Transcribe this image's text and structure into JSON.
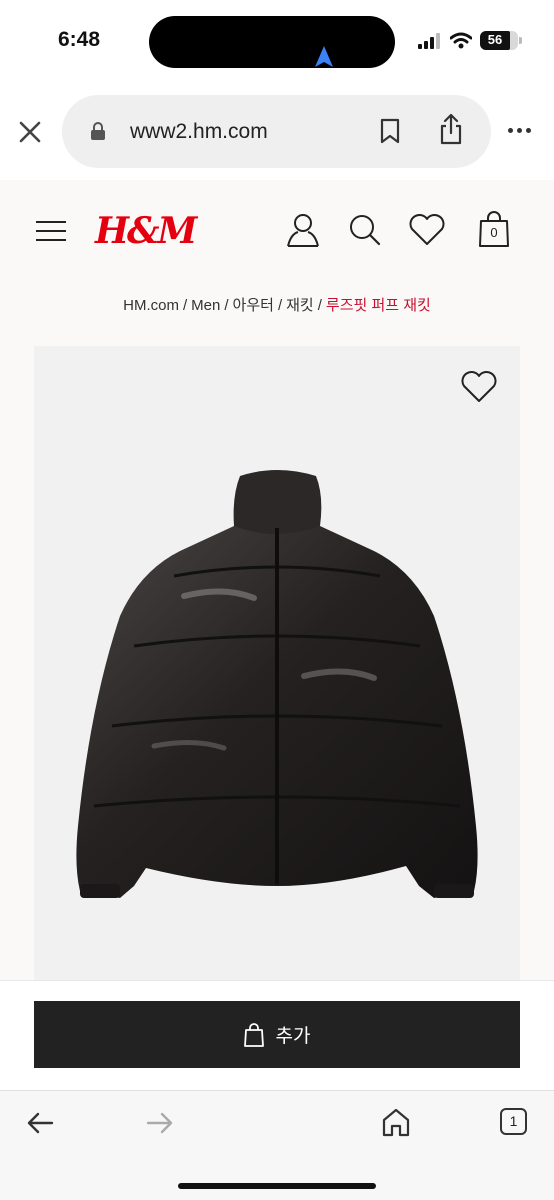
{
  "status": {
    "time": "6:48",
    "battery": "56"
  },
  "browser": {
    "url": "www2.hm.com",
    "tab_count": "1"
  },
  "site": {
    "logo": "H&M",
    "cart_count": "0"
  },
  "breadcrumb": {
    "items": [
      "HM.com",
      "Men",
      "아우터",
      "재킷"
    ],
    "current": "루즈핏 퍼프 재킷",
    "separator": "/"
  },
  "product": {
    "add_to_cart_label": "추가"
  },
  "colors": {
    "brand_red": "#e50010",
    "breadcrumb_active": "#c8102e",
    "button_dark": "#222222"
  },
  "icons": [
    "close-icon",
    "lock-icon",
    "bookmark-icon",
    "share-icon",
    "more-icon",
    "menu-icon",
    "account-icon",
    "search-icon",
    "heart-icon",
    "bag-icon",
    "back-icon",
    "forward-icon",
    "home-icon",
    "tabs-icon"
  ]
}
